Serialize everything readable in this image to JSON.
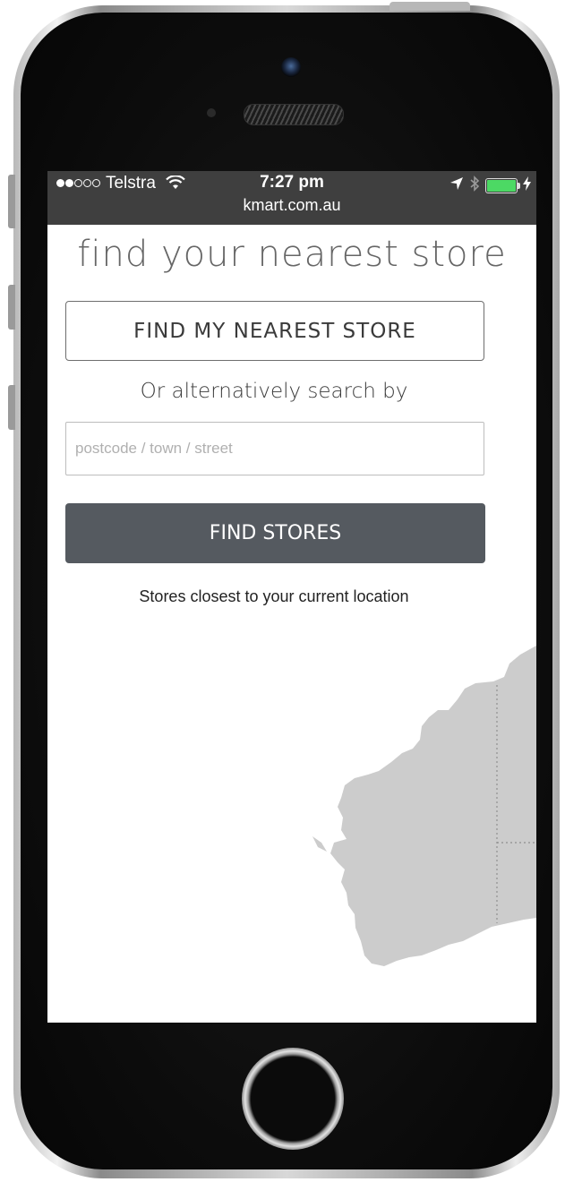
{
  "status_bar": {
    "carrier": "Telstra",
    "time": "7:27 pm",
    "url": "kmart.com.au",
    "signal_bars_filled": 2,
    "signal_bars_total": 5,
    "battery_level": 1.0,
    "icons": [
      "wifi-icon",
      "location-arrow-icon",
      "bluetooth-icon",
      "battery-icon",
      "charging-bolt-icon"
    ]
  },
  "page": {
    "heading": "find your nearest store",
    "nearest_button_label": "FIND MY NEAREST STORE",
    "alternative_text": "Or alternatively search by",
    "search": {
      "placeholder": "postcode / town / street",
      "value": ""
    },
    "find_button_label": "FIND STORES",
    "results_caption": "Stores closest to your current location"
  },
  "colors": {
    "status_bar_bg": "#3f3f3f",
    "find_button_bg": "#555a60",
    "heading_text": "#666666",
    "map_land": "#cccccc",
    "battery_green": "#4cd964"
  }
}
